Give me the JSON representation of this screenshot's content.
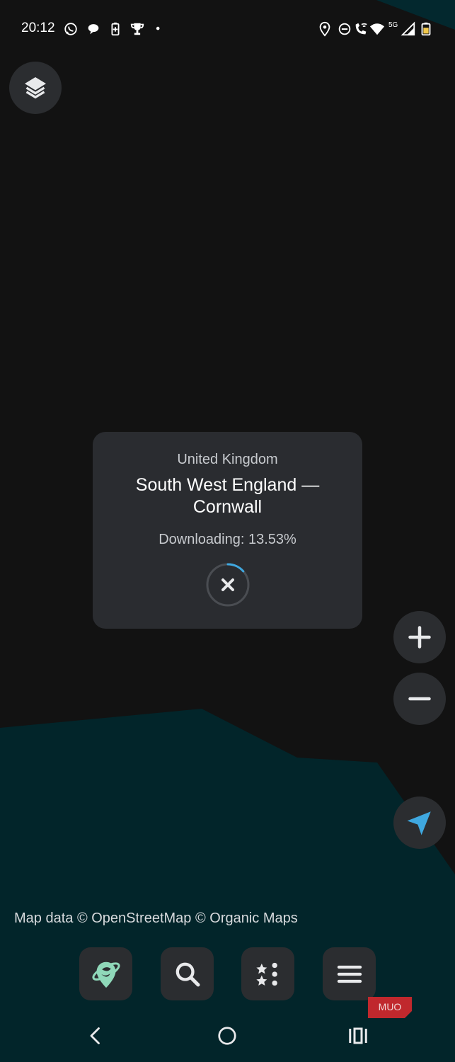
{
  "status_bar": {
    "time": "20:12",
    "network": "5G",
    "left_icons": [
      "whatsapp-icon",
      "chat-bubble-icon",
      "battery-saver-icon",
      "trophy-icon",
      "dot-icon"
    ],
    "right_icons": [
      "location-icon",
      "do-not-disturb-icon",
      "wifi-calling-icon",
      "wifi-icon",
      "signal-icon",
      "battery-icon"
    ]
  },
  "download_dialog": {
    "country": "United Kingdom",
    "region": "South West England — Cornwall",
    "progress_text": "Downloading: 13.53%",
    "progress": 0.1353
  },
  "attribution": "Map data © OpenStreetMap © Organic Maps",
  "controls": {
    "layers": "layers-icon",
    "zoom_in": "plus-icon",
    "zoom_out": "minus-icon",
    "my_position": "navigation-arrow-icon"
  },
  "bottom_nav": [
    "organic-maps-logo-icon",
    "search-icon",
    "bookmarks-icon",
    "menu-icon"
  ],
  "system_nav": [
    "back-icon",
    "home-icon",
    "recents-icon"
  ],
  "watermark": "MUO",
  "colors": {
    "map_land": "#121212",
    "map_water": "#02252a",
    "panel": "#2a2c30",
    "button": "#2b2d30",
    "accent": "#3fa8e0",
    "logo_green": "#8fd8b9",
    "watermark_red": "#c0282d"
  }
}
